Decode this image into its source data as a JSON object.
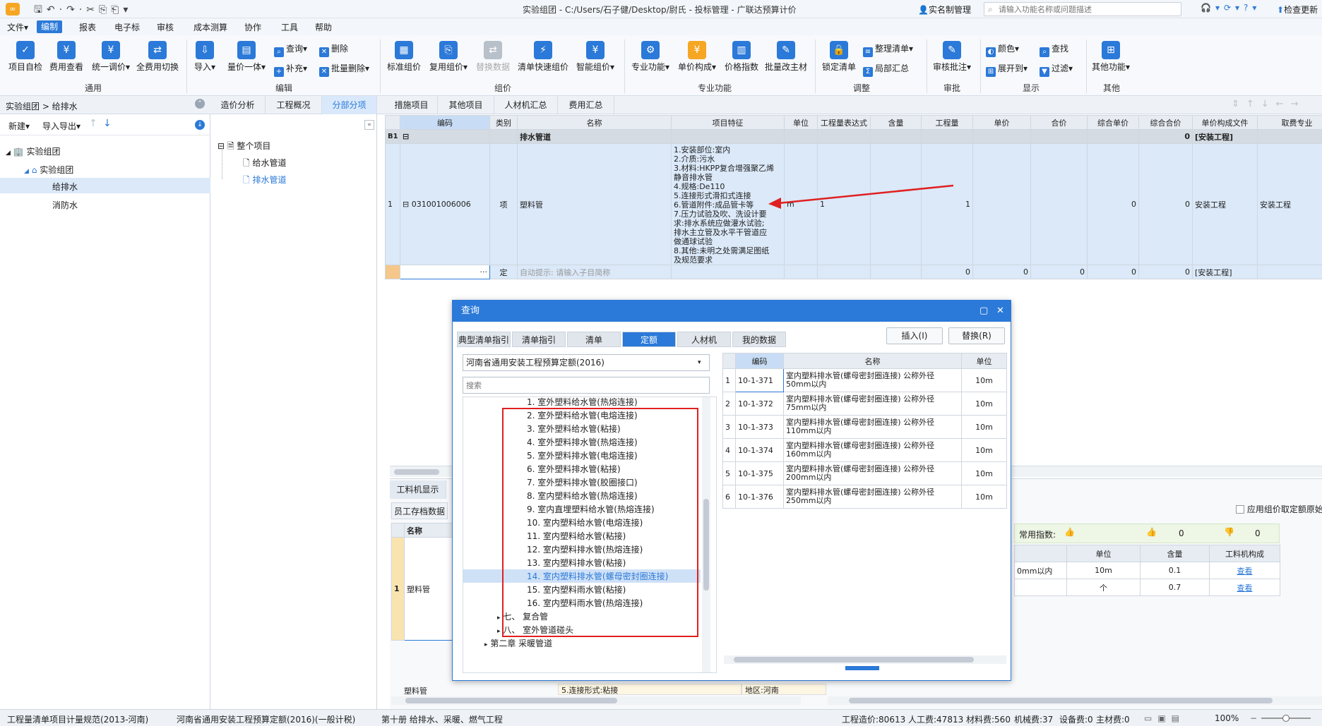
{
  "title": "实验组团 - C:/Users/石子健/Desktop/尉氏 - 投标管理 - 广联达预算计价",
  "realname": "实名制管理",
  "search_placeholder": "请输入功能名称或问题描述",
  "check_update": "检查更新",
  "menu": [
    "文件",
    "编制",
    "报表",
    "电子标",
    "审核",
    "成本测算",
    "协作",
    "工具",
    "帮助"
  ],
  "ribbon": {
    "big": [
      "项目自检",
      "费用查看",
      "统一调价",
      "全费用切换",
      "导入",
      "量价一体",
      "标准组价",
      "复用组价",
      "替换数据",
      "清单快速组价",
      "智能组价",
      "专业功能",
      "单价构成",
      "价格指数",
      "批量改主材",
      "锁定清单",
      "审核批注",
      "其他功能"
    ],
    "small": [
      "查询",
      "删除",
      "补充",
      "批量删除",
      "整理清单",
      "局部汇总",
      "颜色",
      "查找",
      "展开到",
      "过滤"
    ],
    "groups": [
      "通用",
      "编辑",
      "组价",
      "专业功能",
      "调整",
      "审批",
      "显示",
      "其他"
    ]
  },
  "left": {
    "breadcrumb": "实验组团 > 给排水",
    "new_btn": "新建",
    "io_btn": "导入导出",
    "tree": [
      "实验组团",
      "实验组团",
      "给排水",
      "消防水"
    ]
  },
  "mid_tabs": [
    "造价分析",
    "工程概况",
    "分部分项"
  ],
  "mid_tree": [
    "整个项目",
    "给水管道",
    "排水管道"
  ],
  "main_tabs": [
    "措施项目",
    "其他项目",
    "人材机汇总",
    "费用汇总"
  ],
  "grid": {
    "headers": [
      "编码",
      "类别",
      "名称",
      "项目特征",
      "单位",
      "工程量表达式",
      "含量",
      "工程量",
      "单价",
      "合价",
      "综合单价",
      "综合合价",
      "单价构成文件",
      "取费专业"
    ],
    "b1_label": "B1",
    "b1_name": "排水管道",
    "b1_total": "0",
    "b1_file": "[安装工程]",
    "row1": {
      "no": "1",
      "code": "031001006006",
      "type": "项",
      "name": "塑料管",
      "features": [
        "1.安装部位:室内",
        "2.介质:污水",
        "3.材料:HKPP复合增强聚乙烯",
        "静音排水管",
        "4.规格:De110",
        "5.连接形式滑扣式连接",
        "6.管道附件:成品管卡等",
        "7.压力试验及吹、洗设计要",
        "求:排水系统应做灌水试验;",
        "排水主立管及水平干管道应",
        "做通球试验",
        "8.其他:未明之处需满足图纸",
        "及规范要求"
      ],
      "unit": "m",
      "expr": "1",
      "qty": "1",
      "total": "0",
      "ctotal": "0",
      "file": "安装工程",
      "spec": "安装工程"
    },
    "row2": {
      "type": "定",
      "hint": "自动提示: 请输入子目简称",
      "v1": "0",
      "v2": "0",
      "v3": "0",
      "v4": "0",
      "v5": "0",
      "file": "[安装工程]",
      "dots": "···"
    }
  },
  "bottom": {
    "tabs": [
      "工料机显示",
      "员工存档数据"
    ],
    "name_hdr": "名称",
    "row_no": "1",
    "row_name": "塑料管",
    "row2_name": "塑料管",
    "row2_feature": "5.连接形式:粘接",
    "row2_area": "地区:河南",
    "apply_label": "应用组价取定额原始",
    "common_index": "常用指数:",
    "like": "0",
    "dislike": "0",
    "right_headers": [
      "单位",
      "含量",
      "工料机构成"
    ],
    "right_rows": [
      {
        "name": "0mm以内",
        "unit": "10m",
        "amt": "0.1",
        "act": "查看"
      },
      {
        "name": "",
        "unit": "个",
        "amt": "0.7",
        "act": "查看"
      }
    ]
  },
  "dialog": {
    "title": "查询",
    "tabs": [
      "典型清单指引",
      "清单指引",
      "清单",
      "定额",
      "人材机",
      "我的数据"
    ],
    "insert": "插入(I)",
    "replace": "替换(R)",
    "select": "河南省通用安装工程预算定额(2016)",
    "search": "搜索",
    "tree": [
      "1. 室外塑料给水管(热熔连接)",
      "2. 室外塑料给水管(电熔连接)",
      "3. 室外塑料给水管(粘接)",
      "4. 室外塑料排水管(热熔连接)",
      "5. 室外塑料排水管(电熔连接)",
      "6. 室外塑料排水管(粘接)",
      "7. 室外塑料排水管(胶圈接口)",
      "8. 室内塑料给水管(热熔连接)",
      "9. 室内直埋塑料给水管(热熔连接)",
      "10. 室内塑料给水管(电熔连接)",
      "11. 室内塑料给水管(粘接)",
      "12. 室内塑料排水管(热熔连接)",
      "13. 室内塑料排水管(粘接)",
      "14. 室内塑料排水管(螺母密封圈连接)",
      "15. 室内塑料雨水管(粘接)",
      "16. 室内塑料雨水管(热熔连接)",
      "七、 复合管",
      "八、 室外管道碰头",
      "第二章 采暖管道"
    ],
    "grid_headers": [
      "编码",
      "名称",
      "单位"
    ],
    "rows": [
      {
        "no": "1",
        "code": "10-1-371",
        "name": "室内塑料排水管(螺母密封圈连接) 公称外径50mm以内",
        "unit": "10m"
      },
      {
        "no": "2",
        "code": "10-1-372",
        "name": "室内塑料排水管(螺母密封圈连接) 公称外径75mm以内",
        "unit": "10m"
      },
      {
        "no": "3",
        "code": "10-1-373",
        "name": "室内塑料排水管(螺母密封圈连接) 公称外径110mm以内",
        "unit": "10m"
      },
      {
        "no": "4",
        "code": "10-1-374",
        "name": "室内塑料排水管(螺母密封圈连接) 公称外径160mm以内",
        "unit": "10m"
      },
      {
        "no": "5",
        "code": "10-1-375",
        "name": "室内塑料排水管(螺母密封圈连接) 公称外径200mm以内",
        "unit": "10m"
      },
      {
        "no": "6",
        "code": "10-1-376",
        "name": "室内塑料排水管(螺母密封圈连接) 公称外径250mm以内",
        "unit": "10m"
      }
    ]
  },
  "status": {
    "s1": "工程量清单项目计量规范(2013-河南)",
    "s2": "河南省通用安装工程预算定额(2016)(一般计税)",
    "s3": "第十册 给排水、采暖、燃气工程",
    "s4": "工程造价:80613",
    "s5": "人工费:47813",
    "s6": "材料费:560",
    "s7": "机械费:37",
    "s8": "设备费:0",
    "s9": "主材费:0",
    "zoom": "100%"
  },
  "colors": {
    "accent": "#2b79d8",
    "highlight": "#dbe9f9",
    "red": "#e02020"
  }
}
